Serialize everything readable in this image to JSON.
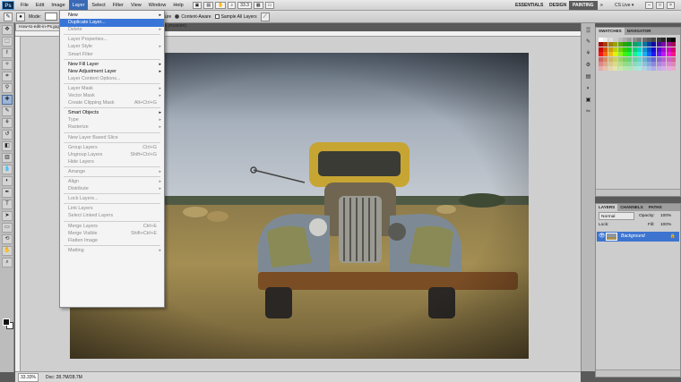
{
  "menubar": {
    "logo": "Ps",
    "items": [
      "File",
      "Edit",
      "Image",
      "Layer",
      "Select",
      "Filter",
      "View",
      "Window",
      "Help"
    ],
    "active": "Layer",
    "zoom": "33.3",
    "workspaces": [
      "ESSENTIALS",
      "DESIGN",
      "PAINTING"
    ],
    "workspace_selected": "PAINTING",
    "more": "»",
    "cslive": "CS Live ▾"
  },
  "optbar": {
    "mode_label": "Mode:",
    "texture_label": "Texture",
    "content_aware_label": "Content-Aware",
    "sample_all_label": "Sample All Layers"
  },
  "document": {
    "tab_title": "How-to-edit-in-Ps.jpg @ 33.3% (RGB/8#)",
    "tab_suffix": "% (RGB/8#)",
    "zoom": "33.33%",
    "doc_info": "Doc: 28.7M/28.7M"
  },
  "layer_menu": [
    {
      "label": "New",
      "arrow": true,
      "disabled": false
    },
    {
      "label": "Duplicate Layer...",
      "highlight": true
    },
    {
      "label": "Delete",
      "arrow": true,
      "disabled": true
    },
    {
      "sep": true
    },
    {
      "label": "Layer Properties...",
      "disabled": true
    },
    {
      "label": "Layer Style",
      "arrow": true,
      "disabled": true
    },
    {
      "label": "Smart Filter",
      "disabled": true
    },
    {
      "sep": true
    },
    {
      "label": "New Fill Layer",
      "arrow": true
    },
    {
      "label": "New Adjustment Layer",
      "arrow": true
    },
    {
      "label": "Layer Content Options...",
      "disabled": true
    },
    {
      "sep": true
    },
    {
      "label": "Layer Mask",
      "arrow": true,
      "disabled": true
    },
    {
      "label": "Vector Mask",
      "arrow": true,
      "disabled": true
    },
    {
      "label": "Create Clipping Mask",
      "shortcut": "Alt+Ctrl+G",
      "disabled": true
    },
    {
      "sep": true
    },
    {
      "label": "Smart Objects",
      "arrow": true
    },
    {
      "label": "Type",
      "arrow": true,
      "disabled": true
    },
    {
      "label": "Rasterize",
      "arrow": true,
      "disabled": true
    },
    {
      "sep": true
    },
    {
      "label": "New Layer Based Slice",
      "disabled": true
    },
    {
      "sep": true
    },
    {
      "label": "Group Layers",
      "shortcut": "Ctrl+G",
      "disabled": true
    },
    {
      "label": "Ungroup Layers",
      "shortcut": "Shift+Ctrl+G",
      "disabled": true
    },
    {
      "label": "Hide Layers",
      "disabled": true
    },
    {
      "sep": true
    },
    {
      "label": "Arrange",
      "arrow": true,
      "disabled": true
    },
    {
      "sep": true
    },
    {
      "label": "Align",
      "arrow": true,
      "disabled": true
    },
    {
      "label": "Distribute",
      "arrow": true,
      "disabled": true
    },
    {
      "sep": true
    },
    {
      "label": "Lock Layers...",
      "disabled": true
    },
    {
      "sep": true
    },
    {
      "label": "Link Layers",
      "disabled": true
    },
    {
      "label": "Select Linked Layers",
      "disabled": true
    },
    {
      "sep": true
    },
    {
      "label": "Merge Layers",
      "shortcut": "Ctrl+E",
      "disabled": true
    },
    {
      "label": "Merge Visible",
      "shortcut": "Shift+Ctrl+E",
      "disabled": true
    },
    {
      "label": "Flatten Image",
      "disabled": true
    },
    {
      "sep": true
    },
    {
      "label": "Matting",
      "arrow": true,
      "disabled": true
    }
  ],
  "swatches_panel": {
    "tabs": [
      "SWATCHES",
      "NAVIGATOR"
    ]
  },
  "layers_panel": {
    "tabs": [
      "LAYERS",
      "CHANNELS",
      "PATHS"
    ],
    "blend_mode": "Normal",
    "opacity_label": "Opacity:",
    "opacity": "100%",
    "lock_label": "Lock:",
    "fill_label": "Fill:",
    "fill": "100%",
    "layer_name": "Background"
  }
}
